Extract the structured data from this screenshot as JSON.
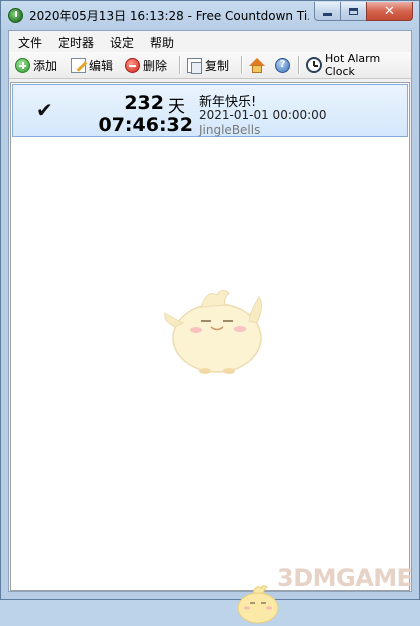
{
  "window": {
    "title": "2020年05月13日 16:13:28 - Free Countdown Ti...",
    "close_glyph": "✕"
  },
  "menu": {
    "items": [
      "文件",
      "定时器",
      "设定",
      "帮助"
    ]
  },
  "toolbar": {
    "add_label": "添加",
    "edit_label": "编辑",
    "delete_label": "删除",
    "copy_label": "复制",
    "help_glyph": "?",
    "hot_alarm_label": "Hot Alarm Clock"
  },
  "timers": [
    {
      "checked": true,
      "check_glyph": "✔",
      "days": "232",
      "days_unit": "天",
      "time_left": "07:46:32",
      "name": "新年快乐!",
      "target": "2021-01-01 00:00:00",
      "sound": "JingleBells"
    }
  ],
  "watermark": "3DMGAME",
  "colors": {
    "row_highlight": "#d4e8fb",
    "titlebar": "#c7dbef",
    "close_button": "#c44a33"
  }
}
